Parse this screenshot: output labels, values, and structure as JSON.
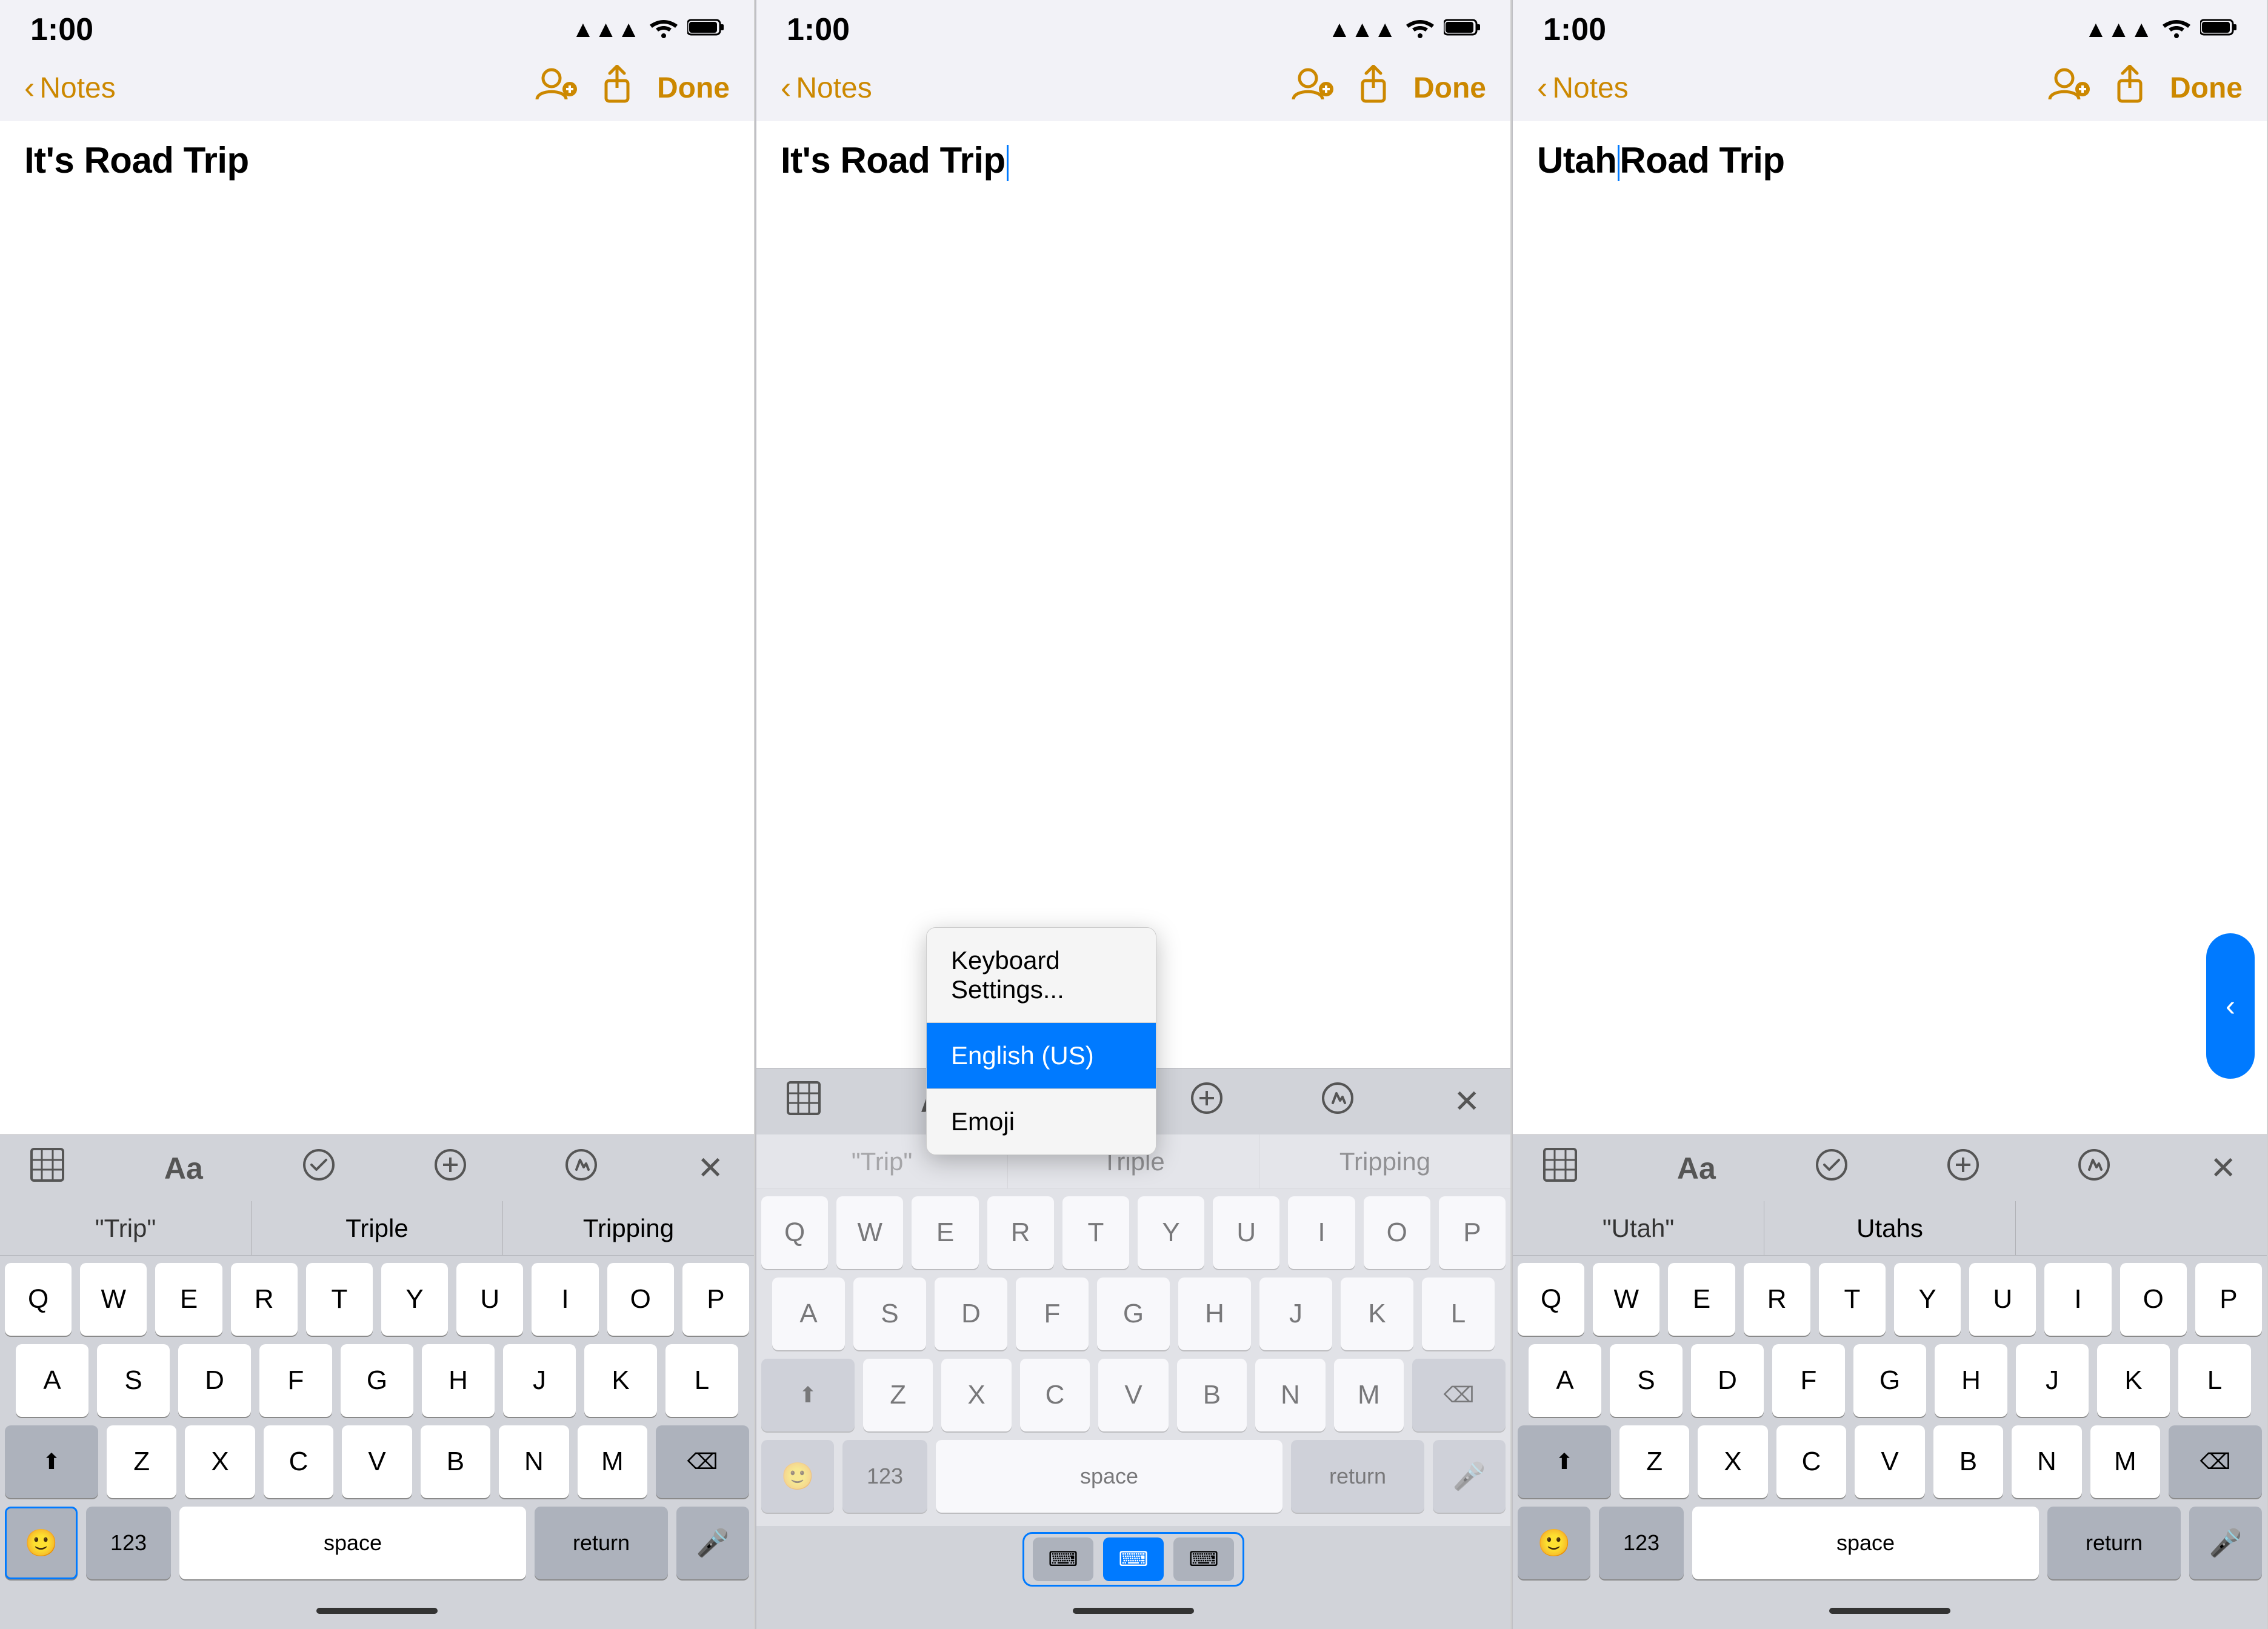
{
  "panels": [
    {
      "id": "panel1",
      "status": {
        "time": "1:00",
        "signal": "●●●",
        "wifi": "wifi",
        "battery": "battery"
      },
      "nav": {
        "back_label": "Notes",
        "done_label": "Done"
      },
      "note_title": "It's Road Trip",
      "autocomplete": [
        "\"Trip\"",
        "Triple",
        "Tripping"
      ],
      "keyboard_rows": [
        [
          "Q",
          "W",
          "E",
          "R",
          "T",
          "Y",
          "U",
          "I",
          "O",
          "P"
        ],
        [
          "A",
          "S",
          "D",
          "F",
          "G",
          "H",
          "J",
          "K",
          "L"
        ],
        [
          "Z",
          "X",
          "C",
          "V",
          "B",
          "N",
          "M"
        ]
      ],
      "bottom_keys": {
        "num": "123",
        "space": "space",
        "return": "return"
      },
      "emoji_active": true
    },
    {
      "id": "panel2",
      "status": {
        "time": "1:00",
        "signal": "●●●",
        "wifi": "wifi",
        "battery": "battery"
      },
      "nav": {
        "back_label": "Notes",
        "done_label": "Done"
      },
      "note_title": "It's Road Trip",
      "autocomplete": [
        "\"Trip\"",
        "Triple",
        "Tripping"
      ],
      "keyboard_rows": [
        [
          "Q",
          "W",
          "E",
          "R",
          "T",
          "Y",
          "U",
          "I",
          "O",
          "P"
        ],
        [
          "A",
          "S",
          "D",
          "F",
          "G",
          "H",
          "J",
          "K",
          "L"
        ],
        [
          "Z",
          "X",
          "C",
          "V",
          "B",
          "N",
          "M"
        ]
      ],
      "bottom_keys": {
        "num": "123",
        "space": "space",
        "return": "return"
      },
      "popup": {
        "items": [
          {
            "label": "Keyboard Settings...",
            "selected": false
          },
          {
            "label": "English (US)",
            "selected": true
          },
          {
            "label": "Emoji",
            "selected": false
          }
        ]
      },
      "kb_selector": {
        "items": [
          {
            "icon": "⌨",
            "active": false
          },
          {
            "icon": "⌨",
            "active": true
          },
          {
            "icon": "⌨",
            "active": false
          }
        ]
      }
    },
    {
      "id": "panel3",
      "status": {
        "time": "1:00",
        "signal": "●●●",
        "wifi": "wifi",
        "battery": "battery"
      },
      "nav": {
        "back_label": "Notes",
        "done_label": "Done"
      },
      "note_title": "Utah Road Trip",
      "autocomplete": [
        "\"Utah\"",
        "Utahs",
        ""
      ],
      "keyboard_rows": [
        [
          "Q",
          "W",
          "E",
          "R",
          "T",
          "Y",
          "U",
          "I",
          "O",
          "P"
        ],
        [
          "A",
          "S",
          "D",
          "F",
          "G",
          "H",
          "J",
          "K",
          "L"
        ],
        [
          "Z",
          "X",
          "C",
          "V",
          "B",
          "N",
          "M"
        ]
      ],
      "bottom_keys": {
        "num": "123",
        "space": "space",
        "return": "return"
      }
    }
  ]
}
